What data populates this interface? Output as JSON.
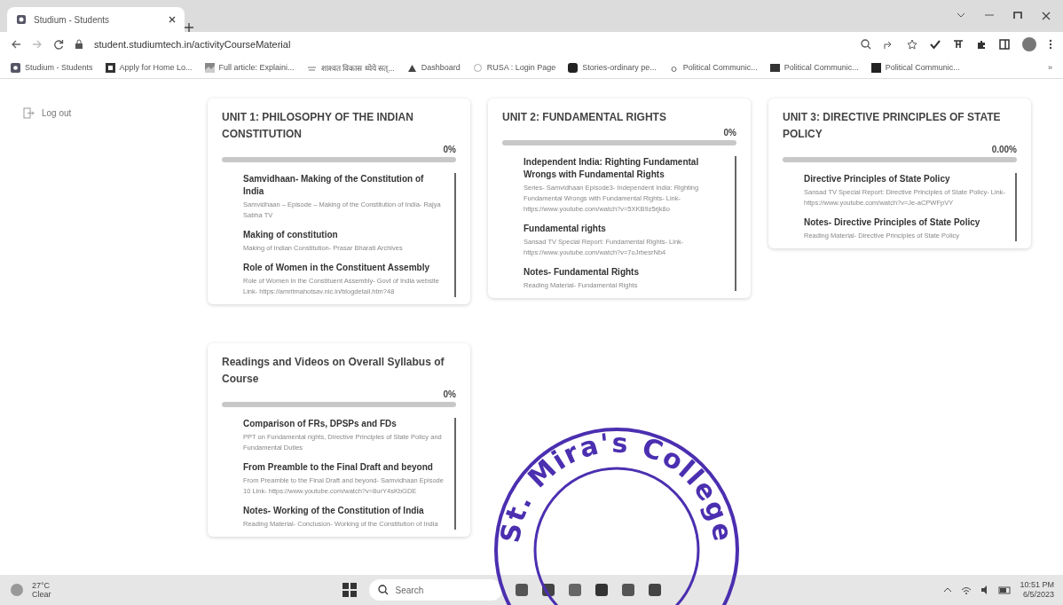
{
  "browser": {
    "tabs": [
      {
        "title": "Studium - Students",
        "selected": true
      }
    ],
    "url": "student.studiumtech.in/activityCourseMaterial",
    "bookmarks": [
      "Studium - Students",
      "Apply for Home Lo...",
      "Full article: Explaini...",
      "शाश्वत विकास ध्येये सत्...",
      "Dashboard",
      "RUSA : Login Page",
      "Stories-ordinary pe...",
      "Political Communic...",
      "Political Communic...",
      "Political Communic..."
    ],
    "more_bookmarks": "»"
  },
  "sidebar": {
    "logout": "Log out"
  },
  "units": [
    {
      "title": "UNIT 1: PHILOSOPHY OF THE INDIAN CONSTITUTION",
      "progress": "0%",
      "level": 0,
      "items": [
        {
          "title": "Samvidhaan- Making of the Constitution of India",
          "description": "Samvidhaan – Episode – Making of the Constitution of India- Rajya Sabha TV"
        },
        {
          "title": "Making of constitution",
          "description": "Making of Indian Constitution- Prasar Bharati Archives"
        },
        {
          "title": "Role of Women in the Constituent Assembly",
          "description": "Role of Women in the Constituent Assembly- Govt of India website Link- https://amritmahotsav.nic.in/blogdetail.htm?48"
        }
      ]
    },
    {
      "title": "UNIT 2: FUNDAMENTAL RIGHTS",
      "progress": "0%",
      "level": 0,
      "items": [
        {
          "title": "Independent India: Righting Fundamental Wrongs with Fundamental Rights",
          "description": "Series- Samvidhaan Episode3- Independent India: Righting Fundamental Wrongs with Fundamental Rights- Link- https://www.youtube.com/watch?v=5XKB9z5rjk8o"
        },
        {
          "title": "Fundamental rights",
          "description": "Sansad TV Special Report: Fundamental Rights- Link- https://www.youtube.com/watch?v=7oJrbesrNb4"
        },
        {
          "title": "Notes- Fundamental Rights",
          "description": "Reading Material- Fundamental Rights"
        }
      ]
    },
    {
      "title": "UNIT 3: DIRECTIVE PRINCIPLES OF STATE POLICY",
      "progress": "0.00%",
      "level": 0,
      "items": [
        {
          "title": "Directive Principles of State Policy",
          "description": "Sansad TV Special Report: Directive Principles of State Policy- Link- https://www.youtube.com/watch?v=Je-aCPWFpVY"
        },
        {
          "title": "Notes- Directive Principles of State Policy",
          "description": "Reading Material- Directive Principles of State Policy"
        }
      ]
    },
    {
      "title": "Readings and Videos on Overall Syllabus of Course",
      "progress": "0%",
      "level": 0,
      "items": [
        {
          "title": "Comparison of FRs, DPSPs and FDs",
          "description": "PPT on Fundamental rights, Directive Principles of State Policy and Fundamental Duties"
        },
        {
          "title": "From Preamble to the Final Draft and beyond",
          "description": "From Preamble to the Final Draft and beyond- Samvidhaan Episode 10 Link- https://www.youtube.com/watch?v=8urY4sKbGDE"
        },
        {
          "title": "Notes- Working of the Constitution of India",
          "description": "Reading Material- Conclusion- Working of the Constitution of India"
        }
      ]
    }
  ],
  "taskbar": {
    "temperature": "27°C",
    "weather": "Clear",
    "search_placeholder": "Search",
    "time": "10:51 PM",
    "date": "6/5/2023"
  },
  "stamp": {
    "text": "St. Mira's College"
  }
}
